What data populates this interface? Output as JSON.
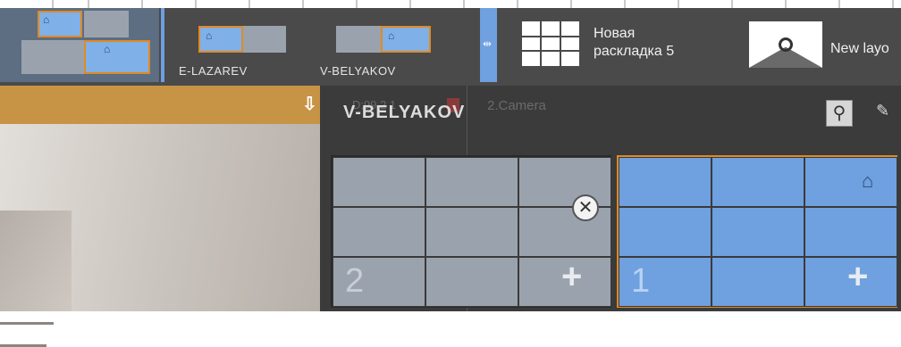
{
  "tabs": [
    {
      "label": "",
      "state": "active"
    },
    {
      "label": "E-LAZAREV"
    },
    {
      "label": "V-BELYAKOV"
    },
    {
      "label": "Новая\nраскладка 5"
    },
    {
      "label": "New layout"
    }
  ],
  "toolbar": {
    "new_layout_line1": "Новая",
    "new_layout_line2": "раскладка 5",
    "new_layout_en": "New layo"
  },
  "video": {
    "ghost_text": "2.Camera",
    "ghost_prefix": "D:99 2 1"
  },
  "panel": {
    "title": "V-BELYAKOV"
  },
  "layouts": [
    {
      "number": "2",
      "color": "#9aa3ad",
      "has_close": true,
      "has_add": true,
      "home": false
    },
    {
      "number": "1",
      "color": "#6fa0df",
      "has_close": false,
      "has_add": true,
      "home": true
    }
  ],
  "colors": {
    "accent_blue": "#6fa0df",
    "orange": "#e08a22",
    "panel": "#3b3b3b",
    "toolbar": "#4a4a4a"
  }
}
